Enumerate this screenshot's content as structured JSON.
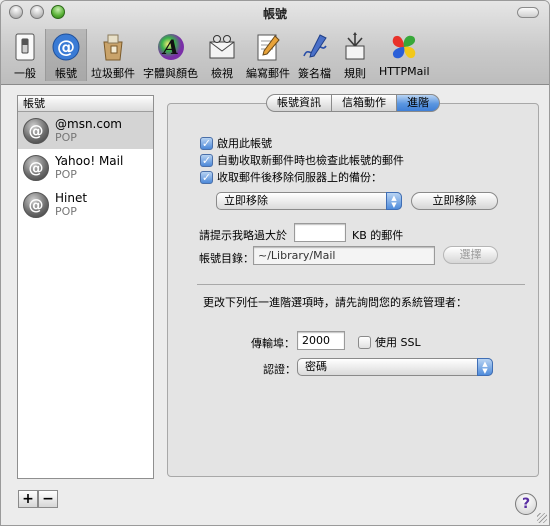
{
  "window": {
    "title": "帳號"
  },
  "toolbar": {
    "items": [
      {
        "label": "一般",
        "icon": "switch-icon"
      },
      {
        "label": "帳號",
        "icon": "at-sign-icon"
      },
      {
        "label": "垃圾郵件",
        "icon": "junk-bag-icon"
      },
      {
        "label": "字體與顏色",
        "icon": "font-icon"
      },
      {
        "label": "檢視",
        "icon": "view-icon"
      },
      {
        "label": "編寫郵件",
        "icon": "compose-icon"
      },
      {
        "label": "簽名檔",
        "icon": "signature-icon"
      },
      {
        "label": "規則",
        "icon": "rules-icon"
      },
      {
        "label": "HTTPMail",
        "icon": "httpmail-icon"
      }
    ],
    "selected": "帳號"
  },
  "accounts": {
    "header": "帳號",
    "items": [
      {
        "name": "@msn.com",
        "type": "POP",
        "selected": true
      },
      {
        "name": "Yahoo! Mail",
        "type": "POP",
        "selected": false
      },
      {
        "name": "Hinet",
        "type": "POP",
        "selected": false
      }
    ],
    "add_label": "+",
    "remove_label": "−"
  },
  "tabs": [
    {
      "label": "帳號資訊",
      "active": false
    },
    {
      "label": "信箱動作",
      "active": false
    },
    {
      "label": "進階",
      "active": true
    }
  ],
  "advanced": {
    "enable_account": {
      "label": "啟用此帳號",
      "checked": true
    },
    "auto_check": {
      "label": "自動收取新郵件時也檢查此帳號的郵件",
      "checked": true
    },
    "remove_copy": {
      "label": "收取郵件後移除伺服器上的備份：",
      "checked": true
    },
    "remove_when": {
      "value": "立即移除"
    },
    "remove_now_button": "立即移除",
    "prompt_label": "請提示我略過大於",
    "prompt_size": "",
    "prompt_unit": "KB 的郵件",
    "dir_label": "帳號目錄：",
    "dir_value": "~/Library/Mail",
    "choose_button": "選擇",
    "admin_note": "更改下列任一進階選項時，請先詢問您的系統管理者：",
    "port_label": "傳輸埠：",
    "port_value": "2000",
    "ssl": {
      "label": "使用 SSL",
      "checked": false
    },
    "auth_label": "認證：",
    "auth_value": "密碼"
  },
  "help_label": "?"
}
